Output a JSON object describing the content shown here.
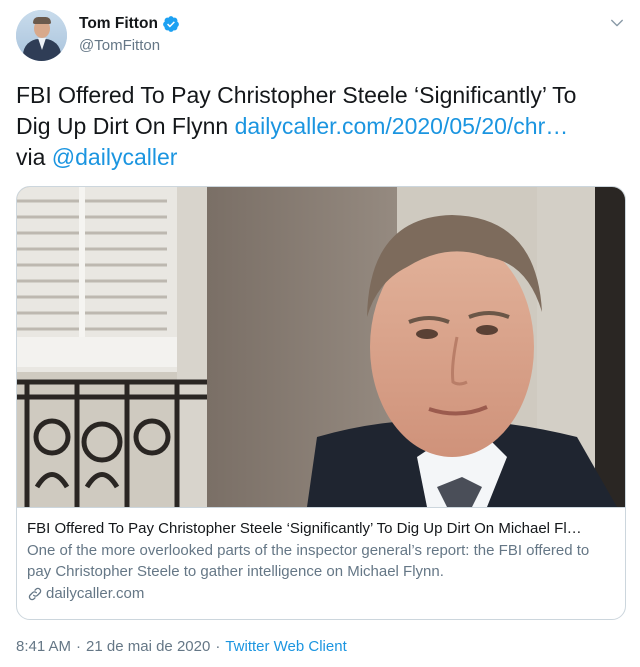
{
  "author": {
    "display_name": "Tom Fitton",
    "handle": "@TomFitton",
    "verified": true
  },
  "icons": {
    "verified": "verified-badge-icon",
    "more": "chevron-down-icon",
    "link": "link-icon"
  },
  "colors": {
    "link": "#1b95e0",
    "secondary_text": "#657786",
    "border": "#ccd6dd",
    "verified": "#1da1f2"
  },
  "tweet": {
    "text_line1": "FBI Offered To Pay Christopher Steele ‘Significantly’ To",
    "text_line2_prefix": "Dig Up Dirt On Flynn ",
    "url": "dailycaller.com/2020/05/20/chr…",
    "via_prefix": "via ",
    "mention": "@dailycaller"
  },
  "card": {
    "title": "FBI Offered To Pay Christopher Steele ‘Significantly’ To Dig Up Dirt On Michael Fl…",
    "description": "One of the more overlooked parts of the inspector general’s report: the FBI offered to pay Christopher Steele to gather intelligence on Michael Flynn.",
    "domain": "dailycaller.com"
  },
  "footer": {
    "time": "8:41 AM",
    "date": "21 de mai de 2020",
    "separator": "·",
    "client": "Twitter Web Client"
  }
}
